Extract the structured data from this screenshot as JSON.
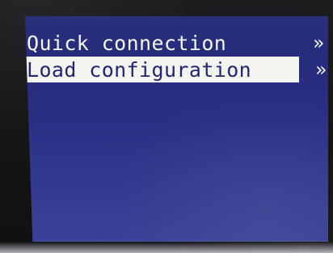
{
  "menu": {
    "items": [
      {
        "label": "Quick connection",
        "selected": false,
        "arrow": "»"
      },
      {
        "label": "Load configuration",
        "selected": true,
        "arrow": "»"
      }
    ]
  },
  "icons": {
    "forward": "chevron-double-right-icon"
  }
}
